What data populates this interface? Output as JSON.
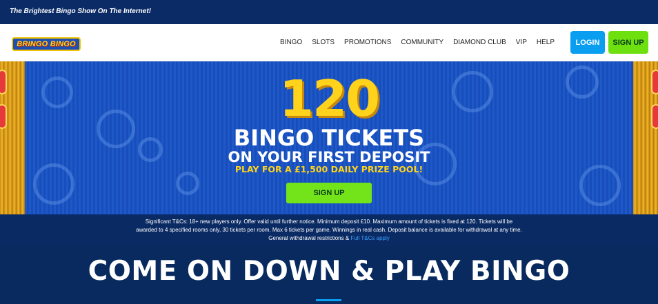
{
  "topbar": {
    "tagline": "The Brightest Bingo Show On The Internet!"
  },
  "brand": {
    "logo_text": "BRINGO BINGO"
  },
  "nav": {
    "items": [
      "BINGO",
      "SLOTS",
      "PROMOTIONS",
      "COMMUNITY",
      "DIAMOND CLUB",
      "VIP",
      "HELP"
    ],
    "login_label": "LOGIN",
    "signup_label": "SIGN UP"
  },
  "hero": {
    "number": "120",
    "line1": "BINGO TICKETS",
    "line2": "ON YOUR FIRST DEPOSIT",
    "line3": "PLAY FOR A £1,500 DAILY PRIZE POOL!",
    "cta_label": "SIGN UP"
  },
  "terms": {
    "text": "Significant T&Cs: 18+ new players only. Offer valid until further notice. Minimum deposit £10. Maximum amount of tickets is fixed at 120. Tickets will be awarded to 4 specified rooms only, 30 tickets per room. Max 6 tickets per game. Winnings in real cash. Deposit balance is available for withdrawal at any time. General withdrawal restrictions &",
    "link_text": "Full T&Cs apply"
  },
  "section": {
    "title": "COME ON DOWN & PLAY BINGO"
  },
  "colors": {
    "navy": "#0b2b66",
    "login_blue": "#0a9ef0",
    "signup_green": "#6ee010",
    "gold": "#ffd21c"
  }
}
